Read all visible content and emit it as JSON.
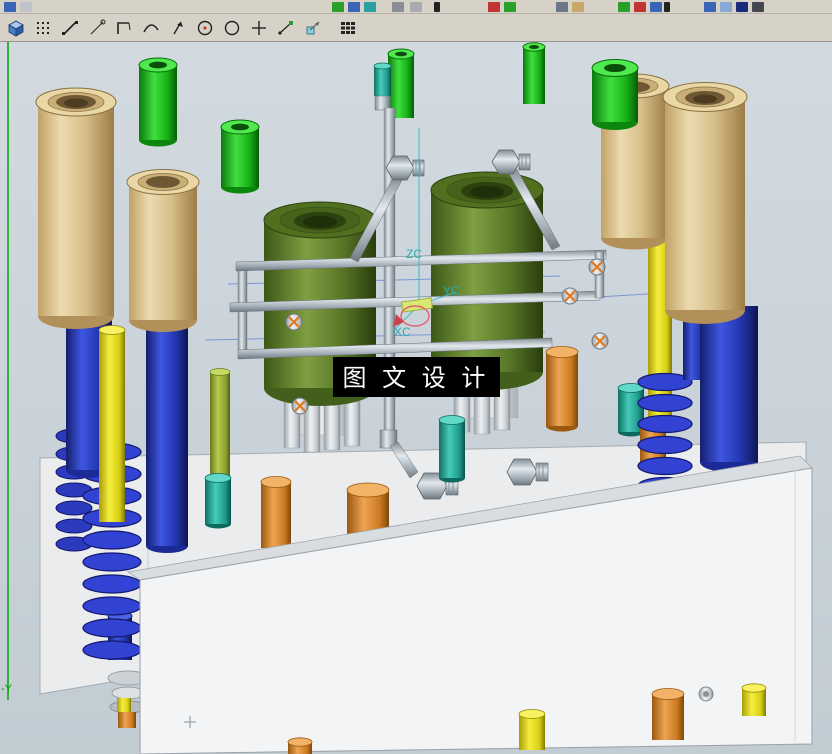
{
  "toolbar": {
    "icons": [
      "orient-view-icon",
      "point-set-icon",
      "line-icon",
      "inferred-line-icon",
      "profile-icon",
      "arc-icon",
      "quick-pick-arrow-icon",
      "circle-center-icon",
      "circle-icon",
      "point-icon",
      "two-point-line-icon",
      "datum-csys-icon",
      "grid-icon"
    ]
  },
  "viewport": {
    "background_color": "#ccd4da",
    "watermark_text": "图 文 设 计",
    "wcs": {
      "z_label": "ZC",
      "y_label": "YC",
      "x_label": "XC"
    },
    "axis_label": "-Y"
  },
  "palette": {
    "guide_bushing_tan": "#d9bf8a",
    "guide_pin_blue": "#2b46c8",
    "spring_blue": "#3242d2",
    "core_olive_green": "#6b8430",
    "bolt_green": "#1ec81e",
    "pin_yellow": "#e8e41c",
    "support_orange": "#d07c24",
    "fitting_teal": "#23a294",
    "pipe_gray": "#aab4bc",
    "plate_white": "#f3f4f5"
  }
}
